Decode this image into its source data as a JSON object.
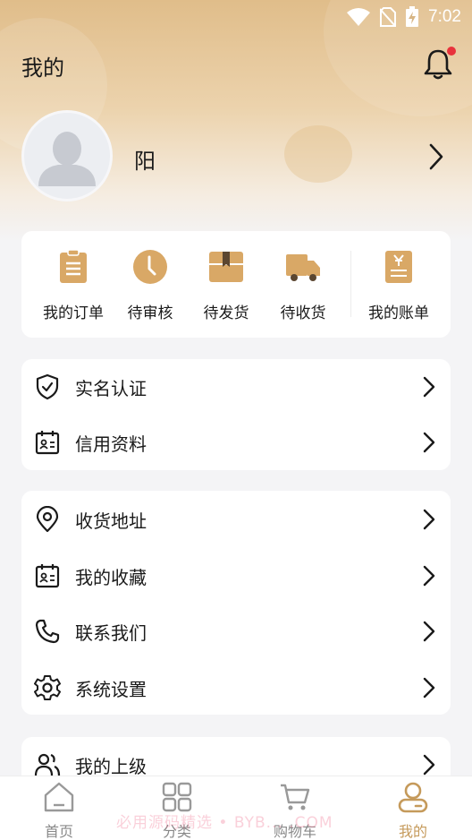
{
  "status": {
    "time": "7:02"
  },
  "header": {
    "title": "我的"
  },
  "profile": {
    "name": "阳"
  },
  "orders": [
    {
      "label": "我的订单",
      "icon": "order-list-icon"
    },
    {
      "label": "待审核",
      "icon": "clock-icon"
    },
    {
      "label": "待发货",
      "icon": "box-icon"
    },
    {
      "label": "待收货",
      "icon": "truck-icon"
    },
    {
      "label": "我的账单",
      "icon": "bill-icon"
    }
  ],
  "menu_group1": [
    {
      "label": "实名认证",
      "icon": "shield-check-icon"
    },
    {
      "label": "信用资料",
      "icon": "id-card-icon"
    }
  ],
  "menu_group2": [
    {
      "label": "收货地址",
      "icon": "location-pin-icon"
    },
    {
      "label": "我的收藏",
      "icon": "id-card-icon"
    },
    {
      "label": "联系我们",
      "icon": "phone-icon"
    },
    {
      "label": "系统设置",
      "icon": "gear-icon"
    }
  ],
  "menu_group3": [
    {
      "label": "我的上级",
      "icon": "users-icon"
    }
  ],
  "tabbar": [
    {
      "label": "首页",
      "icon": "home-icon"
    },
    {
      "label": "分类",
      "icon": "grid-icon"
    },
    {
      "label": "购物车",
      "icon": "cart-icon"
    },
    {
      "label": "我的",
      "icon": "profile-icon"
    }
  ],
  "watermark": "必用源码精选 • BYB... .COM",
  "colors": {
    "accent": "#c59a5b",
    "icon_tan": "#d9a866",
    "notification_dot": "#e8323c"
  }
}
